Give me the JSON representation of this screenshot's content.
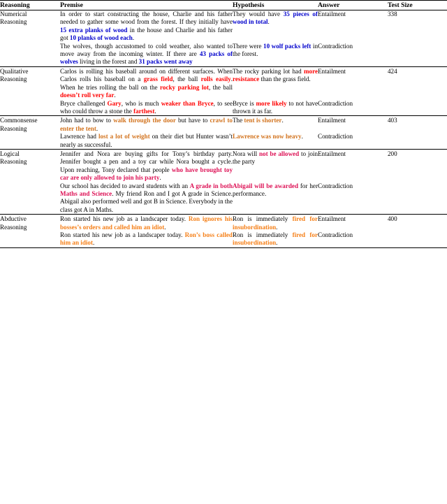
{
  "table": {
    "columns": [
      {
        "key": "reasoning",
        "label": "Reasoning"
      },
      {
        "key": "premise",
        "label": "Premise"
      },
      {
        "key": "hypothesis",
        "label": "Hypothesis"
      },
      {
        "key": "answer",
        "label": "Answer"
      },
      {
        "key": "test_size",
        "label": "Test Size"
      }
    ],
    "colors": {
      "numerical": "#0000CC",
      "qualitative": "#FF0000",
      "commonsense": "#D2731E",
      "logical": "#DD1155",
      "abductive": "#F57F17",
      "text": "#000000",
      "rule": "#000000"
    },
    "groups": [
      {
        "reasoning": "Numerical Reasoning",
        "reasoning_line1": "Numerical",
        "reasoning_line2": "Reasoning",
        "test_size": "338",
        "rows": [
          {
            "premise_plain_1": "In order to start constructing the house, Charlie and his father needed to gather some wood from the forest. If they initially have ",
            "premise_hl_1": "15 extra planks of wood",
            "premise_plain_2": " in the house and Charlie and his father got ",
            "premise_hl_2": "10 planks of wood each",
            "premise_plain_3": ".",
            "hypothesis_plain_1": "They would have ",
            "hypothesis_hl_1": "35 pieces of wood in total",
            "hypothesis_plain_2": ".",
            "answer": "Entailment"
          },
          {
            "premise_plain_1": "The wolves, though accustomed to cold weather, also wanted to move away from the incoming winter. If there are ",
            "premise_hl_1": "43 packs of wolves",
            "premise_plain_2": " living in the forest and ",
            "premise_hl_2": "31 packs went away",
            "premise_plain_3": "",
            "hypothesis_plain_1": "There were ",
            "hypothesis_hl_1": "10 wolf packs left",
            "hypothesis_plain_2": " in the forest.",
            "answer": "Contradiction"
          }
        ]
      },
      {
        "reasoning": "Qualitative Reasoning",
        "reasoning_line1": "Qualitative",
        "reasoning_line2": "Reasoning",
        "test_size": "424",
        "rows": [
          {
            "premise_plain_1": "Carlos is rolling his baseball around on different surfaces. When Carlos rolls his baseball on a ",
            "premise_hl_1": "grass field",
            "premise_plain_2": ", the ball ",
            "premise_hl_2": "rolls easily",
            "premise_plain_3": ". When he tries rolling the ball on the ",
            "premise_hl_3": "rocky parking lot",
            "premise_plain_4": ", the ball ",
            "premise_hl_4": "doesn’t roll very far",
            "premise_plain_5": ".",
            "hypothesis_plain_1": "The rocky parking lot had ",
            "hypothesis_hl_1": "more resistance",
            "hypothesis_plain_2": " than the grass field.",
            "answer": "Entailment"
          },
          {
            "premise_plain_1": "Bryce challenged ",
            "premise_hl_1": "Gary",
            "premise_plain_2": ", who is much ",
            "premise_hl_2": "weaker than Bryce",
            "premise_plain_3": ", to see who could throw a stone the ",
            "premise_hl_3": "farthest",
            "premise_plain_4": ".",
            "hypothesis_plain_1": "Bryce is ",
            "hypothesis_hl_1": "more likely",
            "hypothesis_plain_2": " to not have thrown it as far.",
            "answer": "Contradiction"
          }
        ]
      },
      {
        "reasoning": "Commonsense Reasoning",
        "reasoning_line1": "Commonsense",
        "reasoning_line2": "Reasoning",
        "test_size": "403",
        "rows": [
          {
            "premise_plain_1": "John had to bow to ",
            "premise_hl_1": "walk through the door",
            "premise_plain_2": " but have to ",
            "premise_hl_2": "crawl to enter the tent",
            "premise_plain_3": ".",
            "hypothesis_plain_1": "The ",
            "hypothesis_hl_1": "tent is shorter",
            "hypothesis_plain_2": ".",
            "answer": "Entailment"
          },
          {
            "premise_plain_1": "Lawrence had ",
            "premise_hl_1": "lost a lot of weight",
            "premise_plain_2": " on their diet but Hunter wasn’t nearly as successful.",
            "hypothesis_plain_1": "",
            "hypothesis_hl_1": "Lawrence was now heavy",
            "hypothesis_plain_2": ".",
            "answer": "Contradiction"
          }
        ]
      },
      {
        "reasoning": "Logical Reasoning",
        "reasoning_line1": "Logical",
        "reasoning_line2": "Reasoning",
        "test_size": "200",
        "rows": [
          {
            "premise_plain_1": "Jennifer and Nora are buying gifts for Tony’s birthday party. Jennifer bought a pen and a toy car while Nora bought a cycle. Upon reaching, Tony declared that people ",
            "premise_hl_1": "who have brought toy car are only allowed to join his party",
            "premise_plain_2": ".",
            "hypothesis_plain_1": "Nora will ",
            "hypothesis_hl_1": "not be allowed",
            "hypothesis_plain_2": " to join the party",
            "answer": "Entailment"
          },
          {
            "premise_plain_1": "Our school has decided to award students with an ",
            "premise_hl_1": "A grade in both Maths and Science",
            "premise_plain_2": ". My friend Ron and I got A grade in Science. Abigail also performed well and got B in Science. Everybody in the class got A in Maths.",
            "hypothesis_plain_1": "",
            "hypothesis_hl_1": "Abigail will be awarded",
            "hypothesis_plain_2": " for her performance.",
            "answer": "Contradiction"
          }
        ]
      },
      {
        "reasoning": "Abductive Reasoning",
        "reasoning_line1": "Abductive",
        "reasoning_line2": "Reasoning",
        "test_size": "400",
        "rows": [
          {
            "premise_plain_1": "Ron started his new job as a landscaper today. ",
            "premise_hl_1": "Ron ignores his bosses’s orders and called him an idiot",
            "premise_plain_2": ".",
            "hypothesis_plain_1": "Ron is immediately ",
            "hypothesis_hl_1": "fired for insubordination",
            "hypothesis_plain_2": ".",
            "answer": "Entailment"
          },
          {
            "premise_plain_1": "Ron started his new job as a landscaper today. ",
            "premise_hl_1": "Ron’s boss called him an idiot",
            "premise_plain_2": ".",
            "hypothesis_plain_1": "Ron is immediately ",
            "hypothesis_hl_1": "fired for insubordination",
            "hypothesis_plain_2": ".",
            "answer": "Contradiction"
          }
        ]
      }
    ]
  }
}
